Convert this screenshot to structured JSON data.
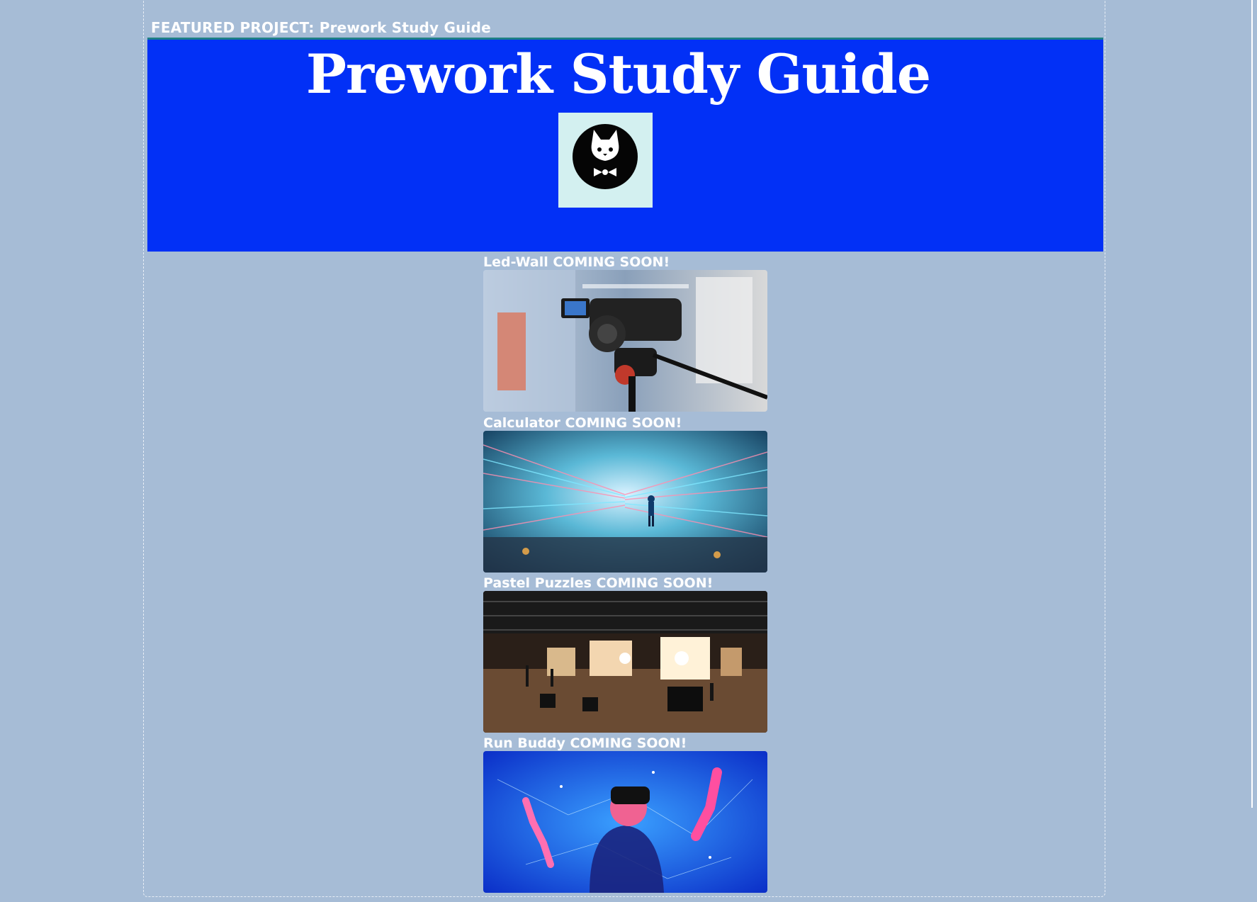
{
  "featured": {
    "label": "FEATURED PROJECT: Prework Study Guide"
  },
  "hero": {
    "title": "Prework Study Guide",
    "background": "#0230f6",
    "logo_icon": "cat-bowtie-logo-icon"
  },
  "projects": [
    {
      "caption": "Led-Wall COMING SOON!",
      "image": "camera-on-tripod-studio-photo"
    },
    {
      "caption": "Calculator COMING SOON!",
      "image": "person-in-neon-light-tunnel-photo"
    },
    {
      "caption": "Pastel Puzzles COMING SOON!",
      "image": "film-studio-set-overview-photo"
    },
    {
      "caption": "Run Buddy COMING SOON!",
      "image": "vr-headset-digital-network-photo"
    }
  ],
  "colors": {
    "page_background": "#a6bcd6",
    "hero_blue": "#0230f6",
    "text": "#ffffff"
  }
}
